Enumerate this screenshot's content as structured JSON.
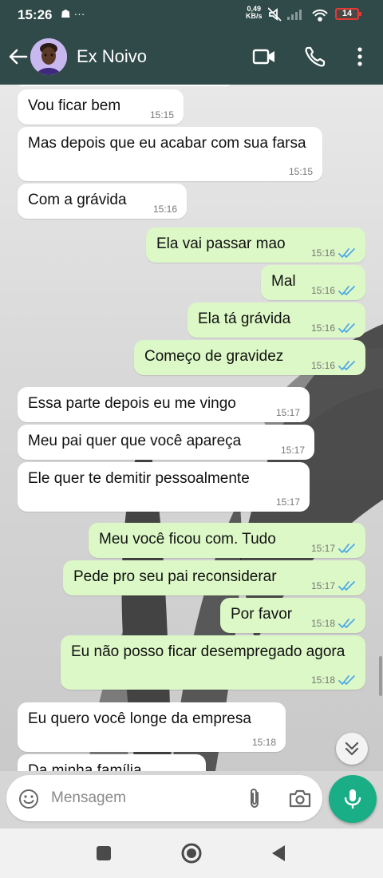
{
  "status_bar": {
    "time": "15:26",
    "left_icons": "☗ ···",
    "net_speed_value": "0,49",
    "net_speed_unit": "KB/s",
    "battery": "14"
  },
  "header": {
    "contact_name": "Ex Noivo",
    "color": "#2f4a48"
  },
  "messages": [
    {
      "dir": "in",
      "text": "Vou ficar bem",
      "time": "15:15"
    },
    {
      "dir": "in",
      "text": "Mas depois que eu acabar com sua farsa",
      "time": "15:15"
    },
    {
      "dir": "in",
      "text": "Com a grávida",
      "time": "15:16"
    },
    {
      "dir": "out",
      "text": "Ela vai passar mao",
      "time": "15:16",
      "read": true
    },
    {
      "dir": "out",
      "text": "Mal",
      "time": "15:16",
      "read": true
    },
    {
      "dir": "out",
      "text": "Ela tá grávida",
      "time": "15:16",
      "read": true
    },
    {
      "dir": "out",
      "text": "Começo de gravidez",
      "time": "15:16",
      "read": true
    },
    {
      "dir": "in",
      "text": "Essa parte depois eu me vingo",
      "time": "15:17"
    },
    {
      "dir": "in",
      "text": "Meu pai quer que você apareça",
      "time": "15:17"
    },
    {
      "dir": "in",
      "text": "Ele quer te demitir pessoalmente",
      "time": "15:17"
    },
    {
      "dir": "out",
      "text": "Meu você ficou com. Tudo",
      "time": "15:17",
      "read": true
    },
    {
      "dir": "out",
      "text": "Pede pro seu pai reconsiderar",
      "time": "15:17",
      "read": true
    },
    {
      "dir": "out",
      "text": "Por favor",
      "time": "15:18",
      "read": true
    },
    {
      "dir": "out",
      "text": "Eu não posso ficar desempregado agora",
      "time": "15:18",
      "read": true
    },
    {
      "dir": "in",
      "text": "Eu quero você longe da empresa",
      "time": "15:18"
    },
    {
      "dir": "in",
      "text": "Da minha família",
      "time": ""
    }
  ],
  "composer": {
    "placeholder": "Mensagem"
  },
  "colors": {
    "incoming_bubble": "#ffffff",
    "outgoing_bubble": "#dcf8c6",
    "read_ticks": "#4fa8e8",
    "mic_button": "#1aae86"
  }
}
